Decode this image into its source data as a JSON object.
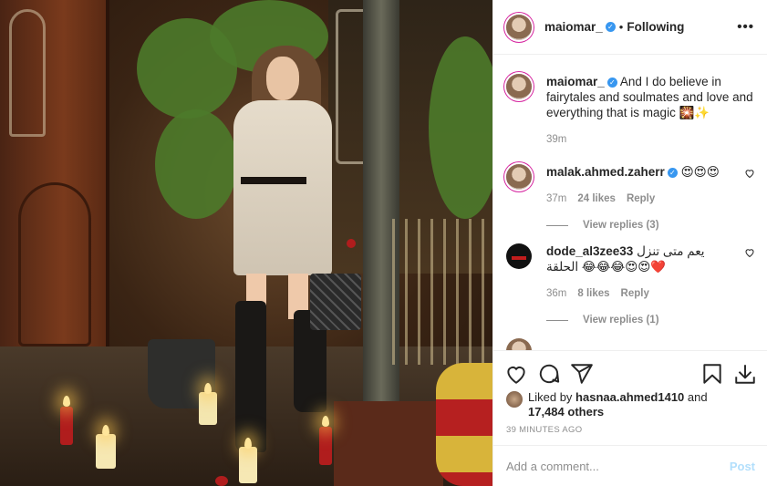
{
  "header": {
    "username": "maiomar_",
    "separator": "•",
    "follow_status": "Following",
    "more": "•••"
  },
  "caption": {
    "username": "maiomar_",
    "text": "And I do believe in fairytales and soulmates and love and everything that is magic 🎇✨",
    "time": "39m"
  },
  "comments": [
    {
      "username": "malak.ahmed.zaherr",
      "verified": true,
      "text": "😍😍😍",
      "time": "37m",
      "likes": "24 likes",
      "reply": "Reply",
      "view_replies": "View replies (3)"
    },
    {
      "username": "dode_al3zee33",
      "text": "يعم متى تنزل الحلقة 😂😂😂😍😍❤️",
      "time": "36m",
      "likes": "8 likes",
      "reply": "Reply",
      "view_replies": "View replies (1)"
    }
  ],
  "likes": {
    "prefix": "Liked by",
    "user": "hasnaa.ahmed1410",
    "and": "and",
    "count": "17,484 others"
  },
  "timestamp": "39 MINUTES AGO",
  "add_comment": {
    "placeholder": "Add a comment...",
    "post_label": "Post"
  },
  "colors": {
    "verified": "#3897f0",
    "post_disabled": "#b2dffc",
    "muted": "#8e8e8e",
    "heart_red": "#e0245e"
  },
  "icons": [
    "heart-icon",
    "comment-icon",
    "share-icon",
    "bookmark-icon",
    "download-icon",
    "more-icon"
  ]
}
